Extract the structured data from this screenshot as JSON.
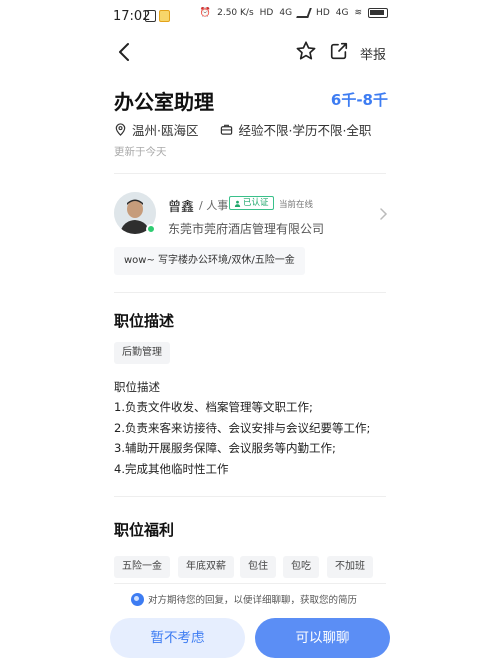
{
  "status_bar": {
    "time": "17:02",
    "net_speed": "2.50 K/s",
    "hd1": "HD",
    "net1": "4G",
    "hd2": "HD",
    "net2": "4G"
  },
  "nav": {
    "report_label": "举报"
  },
  "job": {
    "title": "办公室助理",
    "salary": "6千-8千",
    "location": "温州·瓯海区",
    "requirements": "经验不限·学历不限·全职",
    "updated": "更新于今天"
  },
  "recruiter": {
    "name": "曾鑫",
    "role": "/ 人事",
    "verified_label": "已认证",
    "online_status": "当前在线",
    "company": "东莞市莞府酒店管理有限公司",
    "perks": "wow~ 写字楼办公环境/双休/五险一金"
  },
  "description": {
    "section_title": "职位描述",
    "tag": "后勤管理",
    "lines": [
      "职位描述",
      "1.负责文件收发、档案管理等文职工作;",
      "2.负责来客来访接待、会议安排与会议纪要等工作;",
      "3.辅助开展服务保障、会议服务等内勤工作;",
      "4.完成其他临时性工作"
    ]
  },
  "benefits": {
    "section_title": "职位福利",
    "tags": [
      "五险一金",
      "年底双薪",
      "包住",
      "包吃",
      "不加班"
    ]
  },
  "bottom": {
    "tip": "对方期待您的回复，以便详细聊聊，获取您的简历",
    "decline_label": "暂不考虑",
    "chat_label": "可以聊聊"
  },
  "colors": {
    "accent": "#3d7cf2",
    "online": "#2ecc71",
    "verified": "#1fa76b"
  }
}
